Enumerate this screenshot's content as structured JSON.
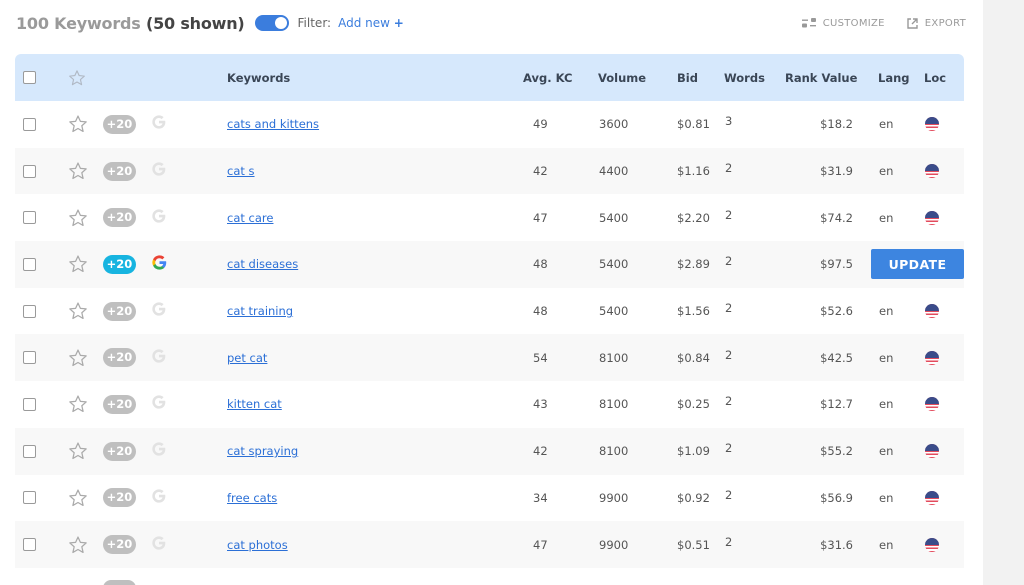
{
  "header": {
    "total_label": "100 Keywords",
    "shown_label": "(50 shown)",
    "toggle_on": true,
    "filter_label": "Filter:",
    "add_new_label": "Add new",
    "add_new_icon": "+",
    "customize_label": "CUSTOMIZE",
    "export_label": "EXPORT"
  },
  "table": {
    "columns": [
      "Keywords",
      "Avg. KC",
      "Volume",
      "Bid",
      "Words",
      "Rank Value",
      "Lang",
      "Loc"
    ],
    "update_label": "UPDATE",
    "rows": [
      {
        "keyword": "cats and kittens",
        "kc": "49",
        "volume": "3600",
        "bid": "$0.81",
        "words": "3",
        "rank": "$18.2",
        "lang": "en",
        "badge": "+20",
        "active": false
      },
      {
        "keyword": "cat s",
        "kc": "42",
        "volume": "4400",
        "bid": "$1.16",
        "words": "2",
        "rank": "$31.9",
        "lang": "en",
        "badge": "+20",
        "active": false
      },
      {
        "keyword": "cat care",
        "kc": "47",
        "volume": "5400",
        "bid": "$2.20",
        "words": "2",
        "rank": "$74.2",
        "lang": "en",
        "badge": "+20",
        "active": false
      },
      {
        "keyword": "cat diseases",
        "kc": "48",
        "volume": "5400",
        "bid": "$2.89",
        "words": "2",
        "rank": "$97.5",
        "lang": "",
        "badge": "+20",
        "active": true
      },
      {
        "keyword": "cat training",
        "kc": "48",
        "volume": "5400",
        "bid": "$1.56",
        "words": "2",
        "rank": "$52.6",
        "lang": "en",
        "badge": "+20",
        "active": false
      },
      {
        "keyword": "pet cat",
        "kc": "54",
        "volume": "8100",
        "bid": "$0.84",
        "words": "2",
        "rank": "$42.5",
        "lang": "en",
        "badge": "+20",
        "active": false
      },
      {
        "keyword": "kitten cat",
        "kc": "43",
        "volume": "8100",
        "bid": "$0.25",
        "words": "2",
        "rank": "$12.7",
        "lang": "en",
        "badge": "+20",
        "active": false
      },
      {
        "keyword": "cat spraying",
        "kc": "42",
        "volume": "8100",
        "bid": "$1.09",
        "words": "2",
        "rank": "$55.2",
        "lang": "en",
        "badge": "+20",
        "active": false
      },
      {
        "keyword": "free cats",
        "kc": "34",
        "volume": "9900",
        "bid": "$0.92",
        "words": "2",
        "rank": "$56.9",
        "lang": "en",
        "badge": "+20",
        "active": false
      },
      {
        "keyword": "cat photos",
        "kc": "47",
        "volume": "9900",
        "bid": "$0.51",
        "words": "2",
        "rank": "$31.6",
        "lang": "en",
        "badge": "+20",
        "active": false
      }
    ]
  },
  "colors": {
    "accent": "#3b7ddd",
    "header_bg": "#d6e8fc",
    "badge_active": "#17b4e0",
    "badge_inactive": "#bfbfbf",
    "update_button": "#3d85e0"
  }
}
